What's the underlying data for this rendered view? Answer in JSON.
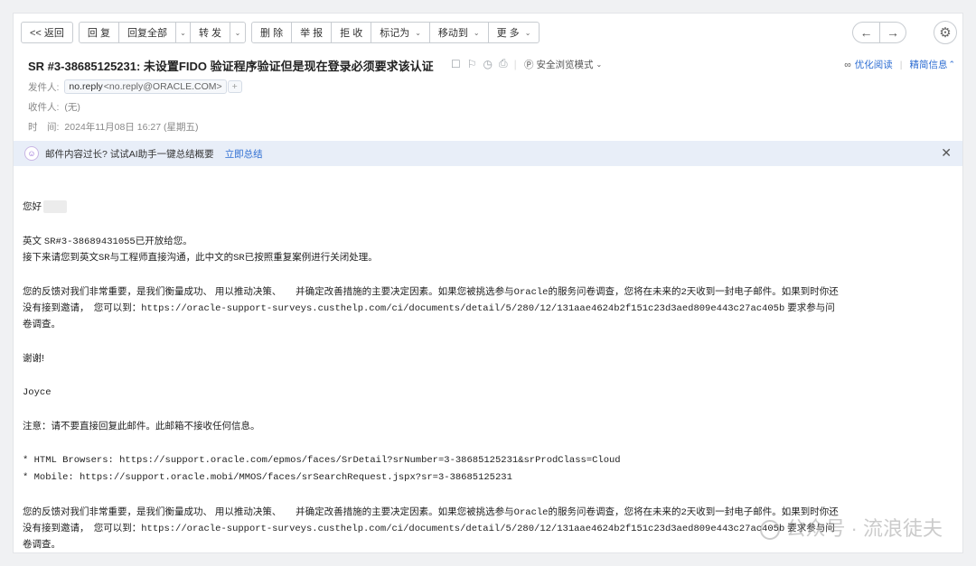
{
  "toolbar": {
    "back": "<< 返回",
    "reply": "回 复",
    "reply_all": "回复全部",
    "forward": "转 发",
    "delete": "删 除",
    "report": "举 报",
    "reject": "拒 收",
    "mark_as": "标记为",
    "move_to": "移动到",
    "more": "更 多"
  },
  "mail": {
    "subject": "SR #3-38685125231: 未设置FIDO 验证程序验证但是现在登录必须要求该认证",
    "safe_mode": "安全浏览模式",
    "optimize_read": "优化阅读",
    "detail_info": "精简信息",
    "from_label": "发件人:",
    "from_name": "no.reply",
    "from_addr": "<no.reply@ORACLE.COM>",
    "to_label": "收件人:",
    "to_value": "(无)",
    "time_label": "时　间:",
    "time_value": "2024年11月08日 16:27 (星期五)"
  },
  "ai_bar": {
    "text": "邮件内容过长? 试试AI助手一键总结概要",
    "link": "立即总结"
  },
  "body": {
    "greeting": "您好",
    "line1a": "英文 ",
    "line1b": "SR#3-38689431055",
    "line1c": "已开放给您。",
    "line2a": "接下来请您到英文",
    "line2b": "SR",
    "line2c": "与工程师直接沟通，此中文的",
    "line2d": "SR",
    "line2e": "已按照重复案例进行关闭处理。",
    "fb1a": "您的反馈对我们非常重要，是我们衡量成功、 用以推动决策、　　并确定改善措施的主要决定因素。如果您被挑选参与",
    "fb1b": "Oracle",
    "fb1c": "的服务问卷调查，您将在未来的",
    "fb1d": "2",
    "fb1e": "天收到一封电子邮件。如果到时你还",
    "fb2a": "没有接到邀请，　您可以到：",
    "fb2b": "https://oracle-support-surveys.custhelp.com/ci/documents/detail/5/280/12/131aae4624b2f151c23d3aed809e443c27ac405b",
    "fb2c": " 要求参与问",
    "fb3": "卷调查。",
    "thanks": "谢谢!",
    "sign": "Joyce",
    "notice": "注意：请不要直接回复此邮件。此邮箱不接收任何信息。",
    "link1": "* HTML Browsers: https://support.oracle.com/epmos/faces/SrDetail?srNumber=3-38685125231&srProdClass=Cloud",
    "link2": "* Mobile: https://support.oracle.mobi/MMOS/faces/srSearchRequest.jspx?sr=3-38685125231"
  },
  "watermark": "公众号 · 流浪徒夫"
}
